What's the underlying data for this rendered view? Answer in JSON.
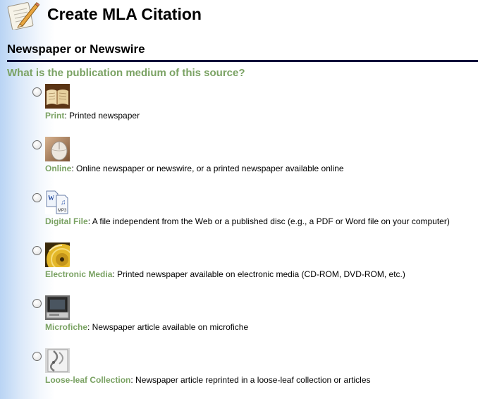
{
  "header": {
    "title": "Create MLA Citation",
    "logo_icon": "pencil-on-notepad-icon"
  },
  "section": {
    "title": "Newspaper or Newswire"
  },
  "question": "What is the publication medium of this source?",
  "colors": {
    "accent_green": "#7aa263",
    "rule": "#0a0a3a",
    "sidebar_gradient": "#b9d4f4"
  },
  "options": [
    {
      "label": "Print",
      "description": ": Printed newspaper",
      "icon": "open-book-icon",
      "selected": false
    },
    {
      "label": "Online",
      "description": ": Online newspaper or newswire, or a printed newspaper available online",
      "icon": "computer-mouse-icon",
      "selected": false
    },
    {
      "label": "Digital File",
      "description": ": A file independent from the Web or a published disc (e.g., a PDF or Word file on your computer)",
      "icon": "digital-file-icon",
      "selected": false
    },
    {
      "label": "Electronic Media",
      "description": ": Printed newspaper available on electronic media (CD-ROM, DVD-ROM, etc.)",
      "icon": "cd-disc-icon",
      "selected": false
    },
    {
      "label": "Microfiche",
      "description": ": Newspaper article available on microfiche",
      "icon": "microfiche-reader-icon",
      "selected": false
    },
    {
      "label": "Loose-leaf Collection",
      "description": ": Newspaper article reprinted in a loose-leaf collection or articles",
      "icon": "binder-ring-icon",
      "selected": false
    }
  ]
}
